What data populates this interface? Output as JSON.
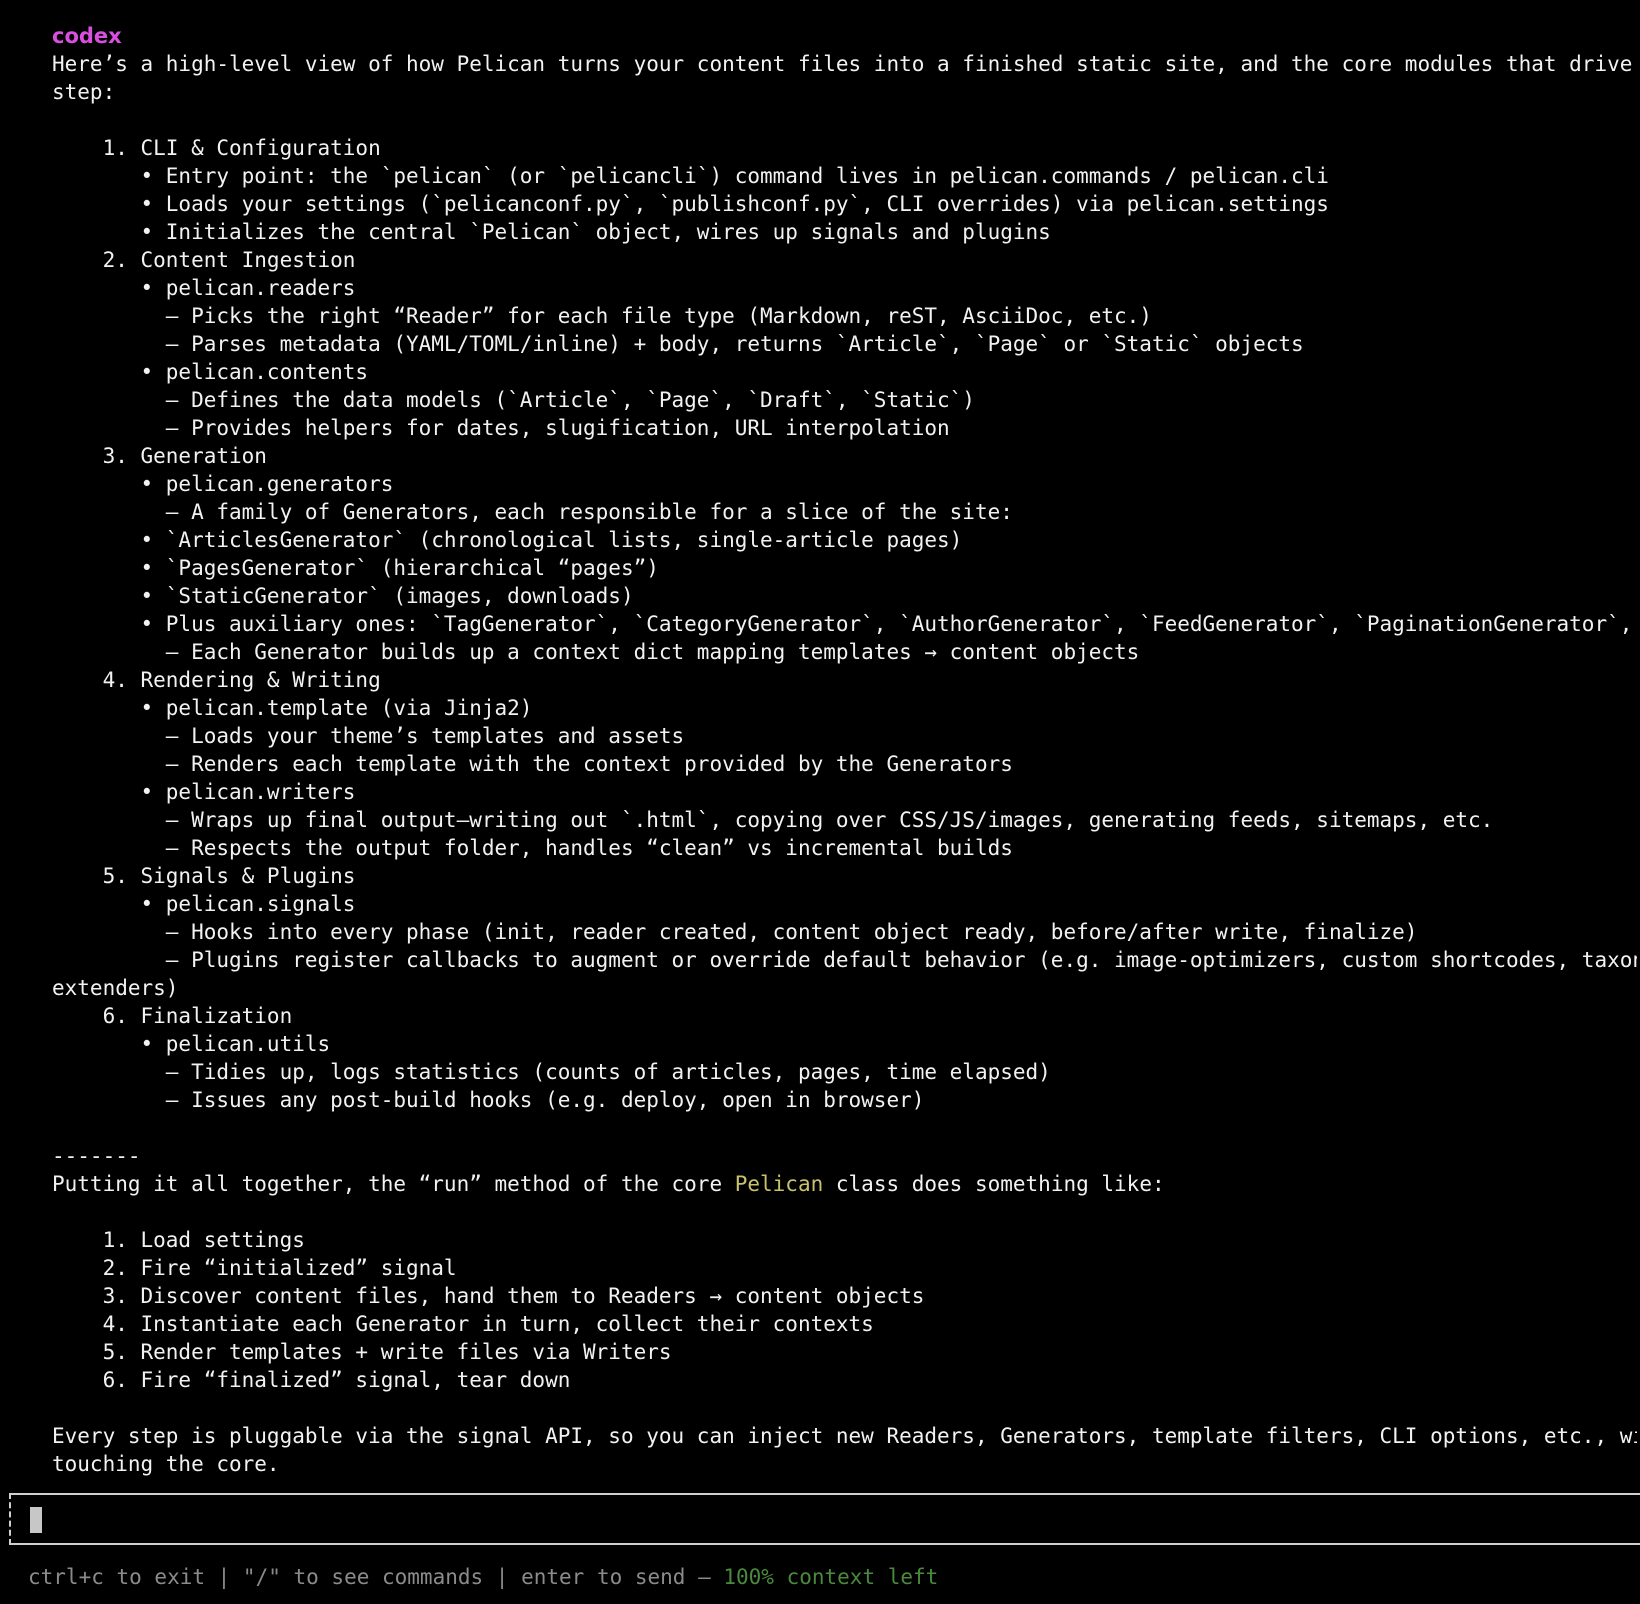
{
  "app": {
    "speaker_label": "codex"
  },
  "message": {
    "lines": [
      "Here’s a high-level view of how Pelican turns your content files into a finished static site, and the core modules that drive each",
      "step:",
      "",
      "    1. CLI & Configuration",
      "       • Entry point: the `pelican` (or `pelicancli`) command lives in pelican.commands / pelican.cli",
      "       • Loads your settings (`pelicanconf.py`, `publishconf.py`, CLI overrides) via pelican.settings",
      "       • Initializes the central `Pelican` object, wires up signals and plugins",
      "    2. Content Ingestion",
      "       • pelican.readers",
      "         – Picks the right “Reader” for each file type (Markdown, reST, AsciiDoc, etc.)",
      "         – Parses metadata (YAML/TOML/inline) + body, returns `Article`, `Page` or `Static` objects",
      "       • pelican.contents",
      "         – Defines the data models (`Article`, `Page`, `Draft`, `Static`)",
      "         – Provides helpers for dates, slugification, URL interpolation",
      "    3. Generation",
      "       • pelican.generators",
      "         – A family of Generators, each responsible for a slice of the site:",
      "       • `ArticlesGenerator` (chronological lists, single-article pages)",
      "       • `PagesGenerator` (hierarchical “pages”)",
      "       • `StaticGenerator` (images, downloads)",
      "       • Plus auxiliary ones: `TagGenerator`, `CategoryGenerator`, `AuthorGenerator`, `FeedGenerator`, `PaginationGenerator`, etc.",
      "         – Each Generator builds up a context dict mapping templates → content objects",
      "    4. Rendering & Writing",
      "       • pelican.template (via Jinja2)",
      "         – Loads your theme’s templates and assets",
      "         – Renders each template with the context provided by the Generators",
      "       • pelican.writers",
      "         – Wraps up final output—writing out `.html`, copying over CSS/JS/images, generating feeds, sitemaps, etc.",
      "         – Respects the output folder, handles “clean” vs incremental builds",
      "    5. Signals & Plugins",
      "       • pelican.signals",
      "         – Hooks into every phase (init, reader created, content object ready, before/after write, finalize)",
      "         – Plugins register callbacks to augment or override default behavior (e.g. image-optimizers, custom shortcodes, taxonomy",
      "extenders)",
      "    6. Finalization",
      "       • pelican.utils",
      "         – Tidies up, logs statistics (counts of articles, pages, time elapsed)",
      "         – Issues any post-build hooks (e.g. deploy, open in browser)",
      "",
      "-------"
    ],
    "summary_prefix": "Putting it all together, the “run” method of the core ",
    "summary_highlight": "Pelican",
    "summary_suffix": " class does something like:",
    "steps": [
      "",
      "    1. Load settings",
      "    2. Fire “initialized” signal",
      "    3. Discover content files, hand them to Readers → content objects",
      "    4. Instantiate each Generator in turn, collect their contexts",
      "    5. Render templates + write files via Writers",
      "    6. Fire “finalized” signal, tear down",
      ""
    ],
    "closing": [
      "Every step is pluggable via the signal API, so you can inject new Readers, Generators, template filters, CLI options, etc., without",
      "touching the core."
    ]
  },
  "input": {
    "value": ""
  },
  "footer": {
    "hint": "ctrl+c to exit | \"/\" to see commands | enter to send — ",
    "context": "100% context left"
  },
  "colors": {
    "background": "#000000",
    "speaker": "#d94fe0",
    "highlight": "#c8c36a",
    "context_left": "#4a8a3c"
  }
}
